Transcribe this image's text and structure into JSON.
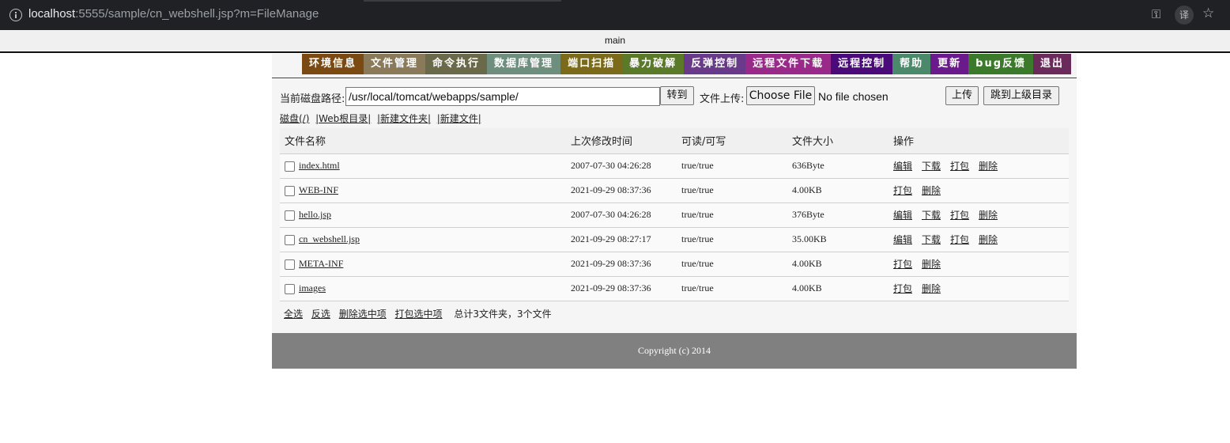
{
  "browser": {
    "url_host": "localhost",
    "url_rest": ":5555/sample/cn_webshell.jsp?m=FileManage",
    "translate_glyph": "译"
  },
  "frame_title": "main",
  "nav": [
    {
      "label": "环境信息",
      "color": "#7a4a12"
    },
    {
      "label": "文件管理",
      "color": "#8a7a5a"
    },
    {
      "label": "命令执行",
      "color": "#6a6a4a"
    },
    {
      "label": "数据库管理",
      "color": "#6e8e7e"
    },
    {
      "label": "端口扫描",
      "color": "#7a6a1a"
    },
    {
      "label": "暴力破解",
      "color": "#5a7a2a"
    },
    {
      "label": "反弹控制",
      "color": "#6a3a8a"
    },
    {
      "label": "远程文件下载",
      "color": "#9a2a8a"
    },
    {
      "label": "远程控制",
      "color": "#4a0a7a"
    },
    {
      "label": "帮助",
      "color": "#4a8a6a"
    },
    {
      "label": "更新",
      "color": "#6a1a8a"
    },
    {
      "label": "bug反馈",
      "color": "#3a7a2a"
    },
    {
      "label": "退出",
      "color": "#6a2a5a"
    }
  ],
  "path_row": {
    "label": "当前磁盘路径:",
    "path_value": "/usr/local/tomcat/webapps/sample/",
    "goto_button": "转到",
    "upload_label": "文件上传:",
    "choose_file_button": "Choose File",
    "no_file_text": "No file chosen",
    "upload_button": "上传",
    "parent_button": "跳到上级目录"
  },
  "links": {
    "disk": "磁盘(/)",
    "web_root": "|Web根目录|",
    "new_folder": "|新建文件夹|",
    "new_file": "|新建文件|"
  },
  "table": {
    "headers": {
      "name": "文件名称",
      "modified": "上次修改时间",
      "rw": "可读/可写",
      "size": "文件大小",
      "ops": "操作"
    },
    "rows": [
      {
        "name": "index.html",
        "modified": "2007-07-30 04:26:28",
        "rw": "true/true",
        "size": "636Byte",
        "ops": [
          "编辑",
          "下载",
          "打包",
          "删除"
        ]
      },
      {
        "name": "WEB-INF",
        "modified": "2021-09-29 08:37:36",
        "rw": "true/true",
        "size": "4.00KB",
        "ops": [
          "打包",
          "删除"
        ]
      },
      {
        "name": "hello.jsp",
        "modified": "2007-07-30 04:26:28",
        "rw": "true/true",
        "size": "376Byte",
        "ops": [
          "编辑",
          "下载",
          "打包",
          "删除"
        ]
      },
      {
        "name": "cn_webshell.jsp",
        "modified": "2021-09-29 08:27:17",
        "rw": "true/true",
        "size": "35.00KB",
        "ops": [
          "编辑",
          "下载",
          "打包",
          "删除"
        ]
      },
      {
        "name": "META-INF",
        "modified": "2021-09-29 08:37:36",
        "rw": "true/true",
        "size": "4.00KB",
        "ops": [
          "打包",
          "删除"
        ]
      },
      {
        "name": "images",
        "modified": "2021-09-29 08:37:36",
        "rw": "true/true",
        "size": "4.00KB",
        "ops": [
          "打包",
          "删除"
        ]
      }
    ]
  },
  "bottom": {
    "select_all": "全选",
    "invert": "反选",
    "delete_selected": "删除选中项",
    "pack_selected": "打包选中项",
    "summary": "总计3文件夹，3个文件"
  },
  "footer": "Copyright (c) 2014"
}
